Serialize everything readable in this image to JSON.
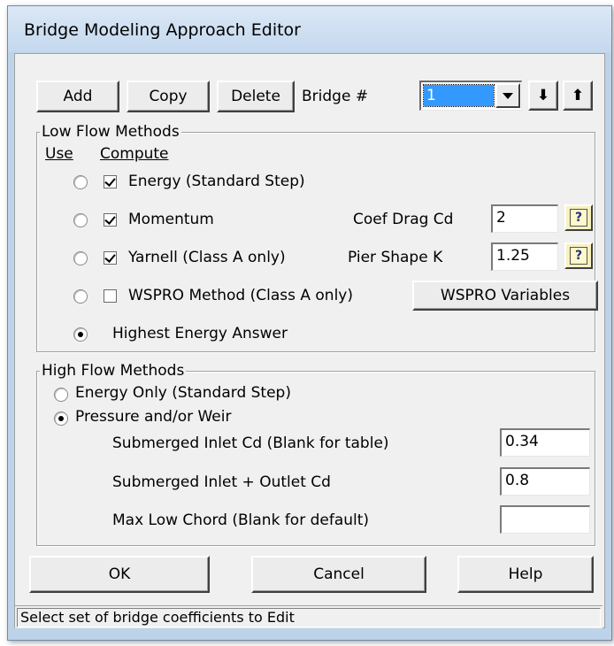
{
  "window": {
    "title": "Bridge Modeling Approach Editor"
  },
  "toolbar": {
    "add_label": "Add",
    "copy_label": "Copy",
    "delete_label": "Delete",
    "bridge_label": "Bridge #",
    "bridge_value": "1",
    "down_arrow": "⬇",
    "up_arrow": "⬆"
  },
  "low_flow": {
    "legend": "Low Flow Methods",
    "use_header": "Use",
    "compute_header": "Compute",
    "methods": [
      {
        "label": "Energy (Standard Step)",
        "use": false,
        "compute": true
      },
      {
        "label": "Momentum",
        "use": false,
        "compute": true
      },
      {
        "label": "Yarnell (Class A only)",
        "use": false,
        "compute": true
      },
      {
        "label": "WSPRO Method (Class A only)",
        "use": false,
        "compute": false
      }
    ],
    "highest_energy_label": "Highest Energy Answer",
    "highest_energy_selected": true,
    "coef_drag_label": "Coef Drag Cd",
    "coef_drag_value": "2",
    "pier_shape_label": "Pier Shape K",
    "pier_shape_value": "1.25",
    "wspro_variables_label": "WSPRO Variables",
    "help_glyph": "?"
  },
  "high_flow": {
    "legend": "High Flow Methods",
    "energy_only_label": "Energy Only (Standard Step)",
    "energy_only_selected": false,
    "pressure_weir_label": "Pressure and/or Weir",
    "pressure_weir_selected": true,
    "submerged_inlet_label": "Submerged Inlet Cd (Blank for table)",
    "submerged_inlet_value": "0.34",
    "submerged_outlet_label": "Submerged Inlet + Outlet Cd",
    "submerged_outlet_value": "0.8",
    "max_low_chord_label": "Max Low Chord (Blank for default)",
    "max_low_chord_value": ""
  },
  "footer": {
    "ok_label": "OK",
    "cancel_label": "Cancel",
    "help_label": "Help"
  },
  "status": {
    "text": "Select set of bridge coefficients to Edit"
  }
}
